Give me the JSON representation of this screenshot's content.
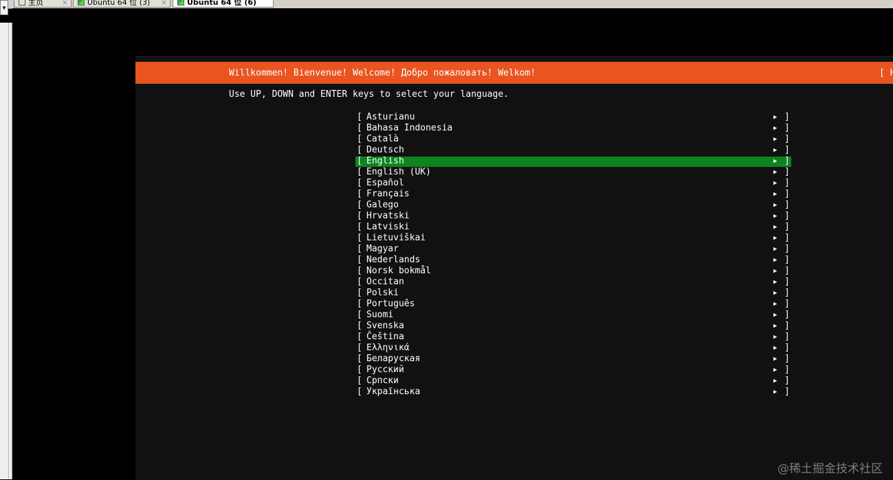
{
  "host": {
    "tabs": [
      {
        "label": "主页",
        "icon": "home-icon"
      },
      {
        "label": "Ubuntu 64 位 (3)",
        "icon": "vm-icon"
      },
      {
        "label": "Ubuntu 64 位 (6)",
        "icon": "vm-icon",
        "active": true
      }
    ],
    "close_glyph": "×",
    "dropdown_glyph": "▼"
  },
  "installer": {
    "header_title": "Willkommen! Bienvenue! Welcome! Добро пожаловать! Welkom!",
    "header_help": "[ H",
    "instruction": "Use UP, DOWN and ENTER keys to select your language.",
    "bracket_open": "[",
    "bracket_close": "]",
    "arrow_glyph": "▶",
    "selected_language": "English",
    "languages": [
      "Asturianu",
      "Bahasa Indonesia",
      "Català",
      "Deutsch",
      "English",
      "English (UK)",
      "Español",
      "Français",
      "Galego",
      "Hrvatski",
      "Latviski",
      "Lietuviškai",
      "Magyar",
      "Nederlands",
      "Norsk bokmål",
      "Occitan",
      "Polski",
      "Português",
      "Suomi",
      "Svenska",
      "Čeština",
      "Ελληνικά",
      "Беларуская",
      "Русский",
      "Српски",
      "Українська"
    ],
    "colors": {
      "header_bg": "#e95420",
      "selection_bg": "#0e8420",
      "background": "#111111"
    }
  },
  "watermark": "@稀土掘金技术社区"
}
